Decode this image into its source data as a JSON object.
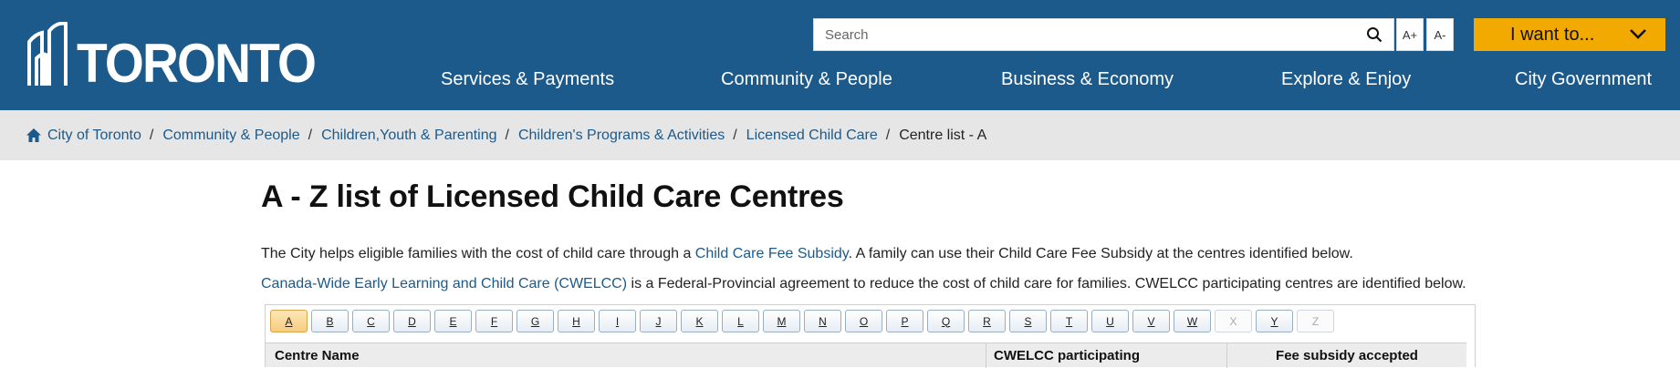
{
  "header": {
    "logo_label": "TORONTO",
    "search": {
      "placeholder": "Search"
    },
    "font_increase": "A+",
    "font_decrease": "A-",
    "want_button": "I want to..."
  },
  "nav": [
    "Services & Payments",
    "Community & People",
    "Business & Economy",
    "Explore & Enjoy",
    "City Government"
  ],
  "breadcrumb": {
    "items": [
      "City of Toronto",
      "Community & People",
      "Children,Youth & Parenting",
      "Children's Programs & Activities",
      "Licensed Child Care"
    ],
    "current": "Centre list - A"
  },
  "page": {
    "title": "A - Z list of Licensed Child Care Centres",
    "p1_before": "The City helps eligible families with the cost of child care through a ",
    "p1_link": "Child Care Fee Subsidy",
    "p1_after": ". A family can use their Child Care Fee Subsidy at the centres identified below.",
    "p2_link": "Canada-Wide Early Learning and Child Care (CWELCC)",
    "p2_after": " is a Federal-Provincial agreement to reduce the cost of child care for families. CWELCC participating centres are identified below."
  },
  "az": {
    "letters": [
      "A",
      "B",
      "C",
      "D",
      "E",
      "F",
      "G",
      "H",
      "I",
      "J",
      "K",
      "L",
      "M",
      "N",
      "O",
      "P",
      "Q",
      "R",
      "S",
      "T",
      "U",
      "V",
      "W",
      "X",
      "Y",
      "Z"
    ],
    "active": "A",
    "disabled": [
      "X",
      "Z"
    ]
  },
  "table": {
    "headers": [
      "Centre Name",
      "CWELCC participating",
      "Fee subsidy accepted"
    ]
  },
  "colors": {
    "header_bg": "#1b5a8b",
    "want_button_bg": "#f2a900",
    "breadcrumb_bg": "#e6e6e6",
    "link": "#1b5a8b"
  }
}
